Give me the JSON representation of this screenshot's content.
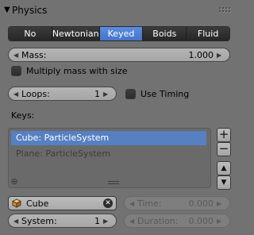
{
  "header": {
    "title": "Physics"
  },
  "tabs": [
    {
      "label": "No",
      "active": false
    },
    {
      "label": "Newtonian",
      "active": false
    },
    {
      "label": "Keyed",
      "active": true
    },
    {
      "label": "Boids",
      "active": false
    },
    {
      "label": "Fluid",
      "active": false
    }
  ],
  "mass": {
    "label": "Mass:",
    "value": "1.000"
  },
  "multiply_mass": {
    "label": "Multiply mass with size",
    "checked": false
  },
  "loops": {
    "label": "Loops:",
    "value": "1"
  },
  "use_timing": {
    "label": "Use Timing",
    "checked": false
  },
  "keys": {
    "label": "Keys:",
    "items": [
      {
        "label": "Cube: ParticleSystem",
        "selected": true
      },
      {
        "label": "Plane: ParticleSystem",
        "selected": false
      }
    ],
    "add_symbol": "+",
    "remove_symbol": "−",
    "up_symbol": "▲",
    "down_symbol": "▼"
  },
  "object": {
    "name": "Cube",
    "clear_symbol": "✕"
  },
  "system": {
    "label": "System:",
    "value": "1"
  },
  "time": {
    "label": "Time:",
    "value": "0.000"
  },
  "duration": {
    "label": "Duration:",
    "value": "0.000"
  },
  "colors": {
    "accent": "#5680c2",
    "panel": "#727272"
  }
}
